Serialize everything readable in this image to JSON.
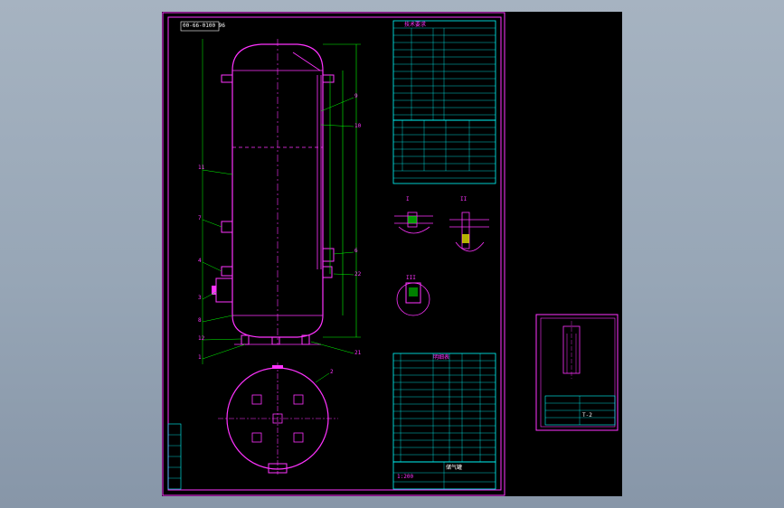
{
  "drawing": {
    "code_box": "00-66-0100 96",
    "part_number_scale": "1:200",
    "detail_titles": [
      "I",
      "II",
      "III"
    ],
    "balloon_labels": [
      "11",
      "7",
      "4",
      "3",
      "8",
      "12",
      "1",
      "9",
      "10",
      "6",
      "22",
      "21",
      "2"
    ]
  },
  "colors": {
    "background": "#97a6b6",
    "sheet": "#000000",
    "geometry": "#ff00ff",
    "leaders": "#00ff00",
    "table_lines": "#00ffff",
    "table_text": "#ffffff",
    "dimension": "#ffff00"
  },
  "tables": {
    "tech_requirements_header": "技术要求",
    "parts_list_header": "明细表",
    "title_block_name": "储气罐",
    "small_sheet_caption": "T-2"
  }
}
